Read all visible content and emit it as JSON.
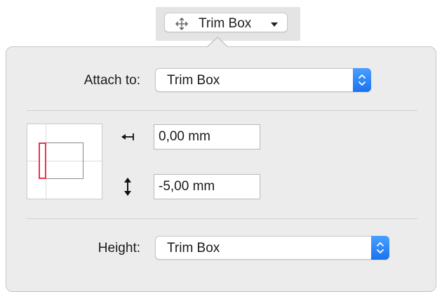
{
  "toolbar": {
    "button_label": "Trim Box",
    "button_icon": "move-arrows-icon",
    "dropdown_icon": "caret-down-icon"
  },
  "popover": {
    "attach_to": {
      "label": "Attach to:",
      "value": "Trim Box"
    },
    "anchor_preview": {
      "highlight_color": "#e8344f"
    },
    "offsets": {
      "horizontal": {
        "icon": "horizontal-offset-icon",
        "value": "0,00 mm"
      },
      "vertical": {
        "icon": "vertical-offset-icon",
        "value": "-5,00 mm"
      }
    },
    "height": {
      "label": "Height:",
      "value": "Trim Box"
    }
  },
  "colors": {
    "accent": "#1a72f0",
    "popover_bg": "#ececec"
  }
}
